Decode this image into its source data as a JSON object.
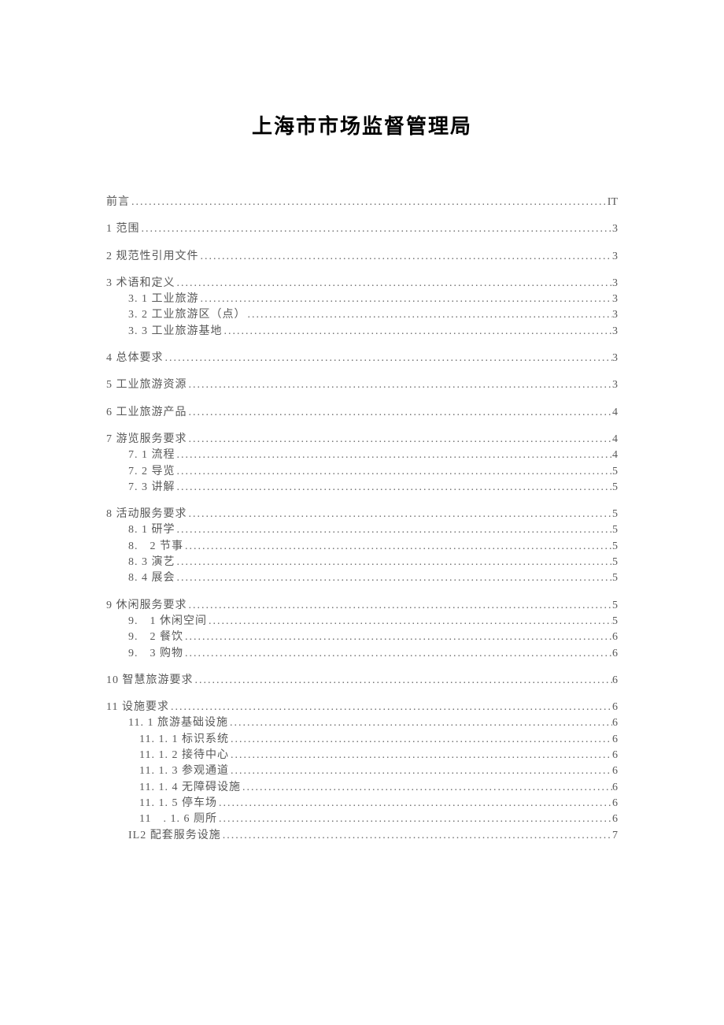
{
  "title": "上海市市场监督管理局",
  "toc": [
    {
      "label": "前言",
      "page": "IT",
      "level": 0,
      "first": true
    },
    {
      "label": "1 范围",
      "page": "3",
      "level": 0
    },
    {
      "label": "2 规范性引用文件",
      "page": "3",
      "level": 0
    },
    {
      "label": "3 术语和定义",
      "page": "3",
      "level": 0
    },
    {
      "label": "3. 1 工业旅游",
      "page": "3",
      "level": 1
    },
    {
      "label": "3. 2 工业旅游区（点）",
      "page": "3",
      "level": 1
    },
    {
      "label": "3. 3 工业旅游基地",
      "page": "3",
      "level": 1
    },
    {
      "label": "4 总体要求",
      "page": "3",
      "level": 0
    },
    {
      "label": "5 工业旅游资源",
      "page": "3",
      "level": 0
    },
    {
      "label": "6 工业旅游产品",
      "page": "4",
      "level": 0
    },
    {
      "label": "7 游览服务要求",
      "page": "4",
      "level": 0
    },
    {
      "label": "7. 1 流程",
      "page": "4",
      "level": 1
    },
    {
      "label": "7. 2 导览",
      "page": "5",
      "level": 1
    },
    {
      "label": "7. 3 讲解",
      "page": "5",
      "level": 1
    },
    {
      "label": "8 活动服务要求",
      "page": "5",
      "level": 0
    },
    {
      "label": "8. 1 研学",
      "page": "5",
      "level": 1
    },
    {
      "label": "8.　2 节事",
      "page": "5",
      "level": 1
    },
    {
      "label": "8. 3 演艺",
      "page": "5",
      "level": 1
    },
    {
      "label": "8. 4 展会",
      "page": "5",
      "level": 1
    },
    {
      "label": "9 休闲服务要求",
      "page": "5",
      "level": 0
    },
    {
      "label": "9.　1 休闲空间",
      "page": "5",
      "level": 1
    },
    {
      "label": "9.　2 餐饮",
      "page": "6",
      "level": 1
    },
    {
      "label": "9.　3 购物",
      "page": "6",
      "level": 1
    },
    {
      "label": "10 智慧旅游要求",
      "page": "6",
      "level": 0
    },
    {
      "label": "11 设施要求",
      "page": "6",
      "level": 0
    },
    {
      "label": "11. 1 旅游基础设施",
      "page": "6",
      "level": 1
    },
    {
      "label": "11. 1. 1 标识系统",
      "page": "6",
      "level": 2
    },
    {
      "label": "11. 1. 2 接待中心",
      "page": "6",
      "level": 2
    },
    {
      "label": "11. 1. 3 参观通道",
      "page": "6",
      "level": 2
    },
    {
      "label": "11. 1. 4 无障碍设施",
      "page": "6",
      "level": 2
    },
    {
      "label": "11. 1. 5 停车场",
      "page": "6",
      "level": 2
    },
    {
      "label": "11　. 1. 6 厕所",
      "page": "6",
      "level": 2
    },
    {
      "label": "IL2 配套服务设施",
      "page": "7",
      "level": 1
    }
  ]
}
